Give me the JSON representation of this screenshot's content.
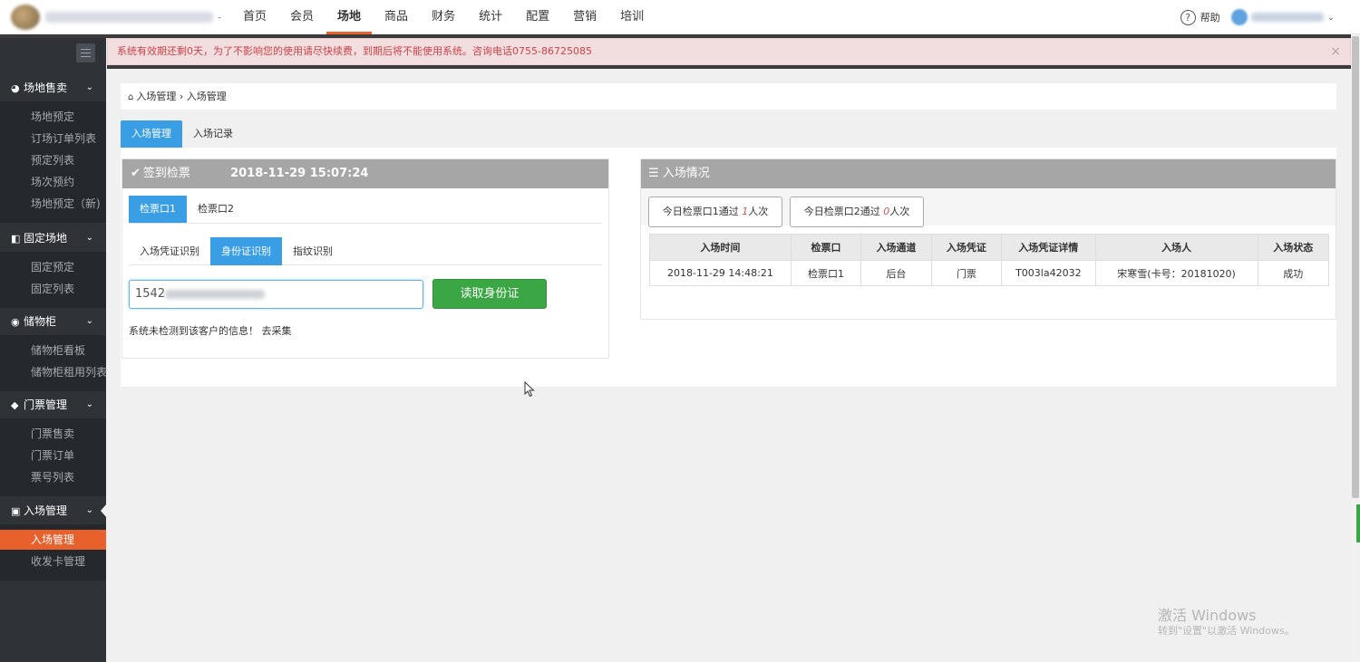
{
  "topbar": {
    "nav": [
      "首页",
      "会员",
      "场地",
      "商品",
      "财务",
      "统计",
      "配置",
      "营销",
      "培训"
    ],
    "nav_active": "场地",
    "help_label": "帮助"
  },
  "alert": {
    "message": "系统有效期还剩0天，为了不影响您的使用请尽快续费，到期后将不能使用系统。咨询电话0755-86725085",
    "close": "×"
  },
  "sidebar": {
    "groups": [
      {
        "icon": "◕",
        "label": "场地售卖",
        "items": [
          "场地预定",
          "订场订单列表",
          "预定列表",
          "场次预约",
          "场地预定（新)"
        ]
      },
      {
        "icon": "◧",
        "label": "固定场地",
        "items": [
          "固定预定",
          "固定列表"
        ]
      },
      {
        "icon": "◉",
        "label": "储物柜",
        "items": [
          "储物柜看板",
          "储物柜租用列表"
        ]
      },
      {
        "icon": "◆",
        "label": "门票管理",
        "items": [
          "门票售卖",
          "门票订单",
          "票号列表"
        ]
      },
      {
        "icon": "▣",
        "label": "入场管理",
        "items": [
          "入场管理",
          "收发卡管理"
        ]
      }
    ],
    "active_item": "入场管理"
  },
  "breadcrumb": {
    "home": "入场管理",
    "sep": "›",
    "current": "入场管理"
  },
  "tabs": [
    "入场管理",
    "入场记录"
  ],
  "checkin": {
    "title": "签到检票",
    "datetime": "2018-11-29 15:07:24",
    "gates": [
      "检票口1",
      "检票口2"
    ],
    "methods": [
      "入场凭证识别",
      "身份证识别",
      "指纹识别"
    ],
    "id_value": "1542",
    "read_button": "读取身份证",
    "notice": "系统未检测到该客户的信息！",
    "collect_link": "去采集"
  },
  "status": {
    "title": "入场情况",
    "gate1": {
      "prefix": "今日检票口1通过",
      "count": "1",
      "suffix": "人次"
    },
    "gate2": {
      "prefix": "今日检票口2通过",
      "count": "0",
      "suffix": "人次"
    },
    "columns": [
      "入场时间",
      "检票口",
      "入场通道",
      "入场凭证",
      "入场凭证详情",
      "入场人",
      "入场状态"
    ],
    "rows": [
      [
        "2018-11-29 14:48:21",
        "检票口1",
        "后台",
        "门票",
        "T003la42032",
        "宋寒雪(卡号：20181020)",
        "成功"
      ]
    ]
  },
  "watermark": {
    "line1": "激活 Windows",
    "line2": "转到\"设置\"以激活 Windows。"
  }
}
